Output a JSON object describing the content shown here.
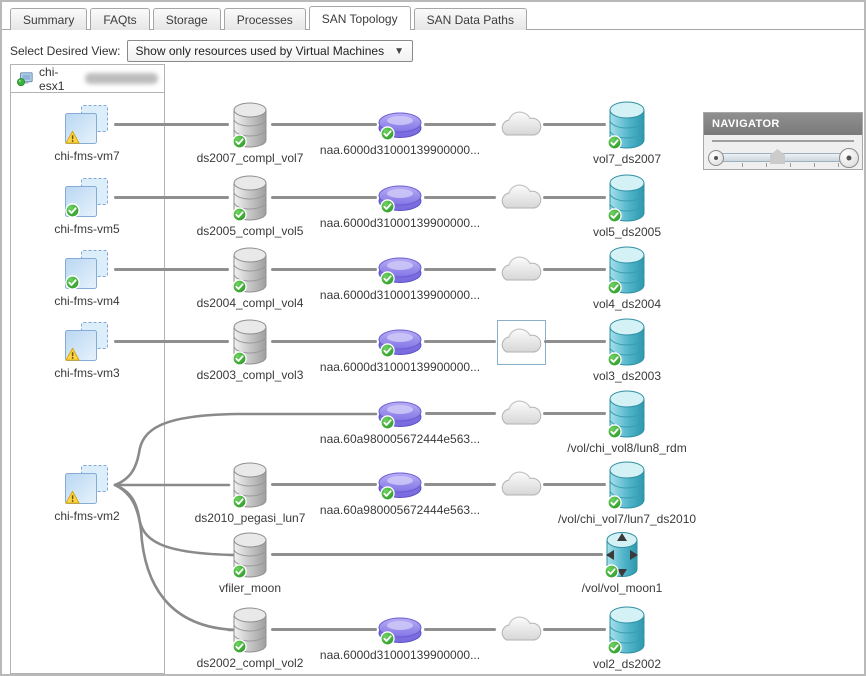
{
  "tabs": [
    {
      "label": "Summary",
      "active": false
    },
    {
      "label": "FAQts",
      "active": false
    },
    {
      "label": "Storage",
      "active": false
    },
    {
      "label": "Processes",
      "active": false
    },
    {
      "label": "SAN Topology",
      "active": true
    },
    {
      "label": "SAN Data Paths",
      "active": false
    }
  ],
  "toolbar": {
    "view_label": "Select Desired View:",
    "view_value": "Show only resources used by Virtual Machines"
  },
  "host": {
    "name": "chi-esx1"
  },
  "navigator": {
    "title": "NAVIGATOR"
  },
  "colors": {
    "line": "#8f8f8f",
    "selection_border": "#8ab0cc",
    "ok_badge": "#2fa52f",
    "warning_badge": "#ffd54a",
    "lun": "#9b8ef2",
    "volume": "#4fb6c9",
    "datastore": "#c0c0c0"
  },
  "diagram": {
    "rows": {
      "r1": {
        "vm": "chi-fms-vm7",
        "vm_status": "warning",
        "ds": "ds2007_compl_vol7",
        "lun": "naa.6000d31000139900000...",
        "vol": "vol7_ds2007"
      },
      "r2": {
        "vm": "chi-fms-vm5",
        "vm_status": "ok",
        "ds": "ds2005_compl_vol5",
        "lun": "naa.6000d31000139900000...",
        "vol": "vol5_ds2005"
      },
      "r3": {
        "vm": "chi-fms-vm4",
        "vm_status": "ok",
        "ds": "ds2004_compl_vol4",
        "lun": "naa.6000d31000139900000...",
        "vol": "vol4_ds2004"
      },
      "r4": {
        "vm": "chi-fms-vm3",
        "vm_status": "warning",
        "ds": "ds2003_compl_vol3",
        "lun": "naa.6000d31000139900000...",
        "vol": "vol3_ds2003",
        "cloud_selected": true
      },
      "g": {
        "vm": "chi-fms-vm2",
        "vm_status": "warning"
      },
      "a": {
        "lun": "naa.60a980005672444e563...",
        "vol": "/vol/chi_vol8/lun8_rdm"
      },
      "b": {
        "ds": "ds2010_pegasi_lun7",
        "lun": "naa.60a980005672444e563...",
        "vol": "/vol/chi_vol7/lun7_ds2010"
      },
      "c": {
        "ds": "vfiler_moon",
        "vol": "/vol/vol_moon1"
      },
      "d": {
        "ds": "ds2002_compl_vol2",
        "lun": "naa.6000d31000139900000...",
        "vol": "vol2_ds2002"
      }
    }
  }
}
